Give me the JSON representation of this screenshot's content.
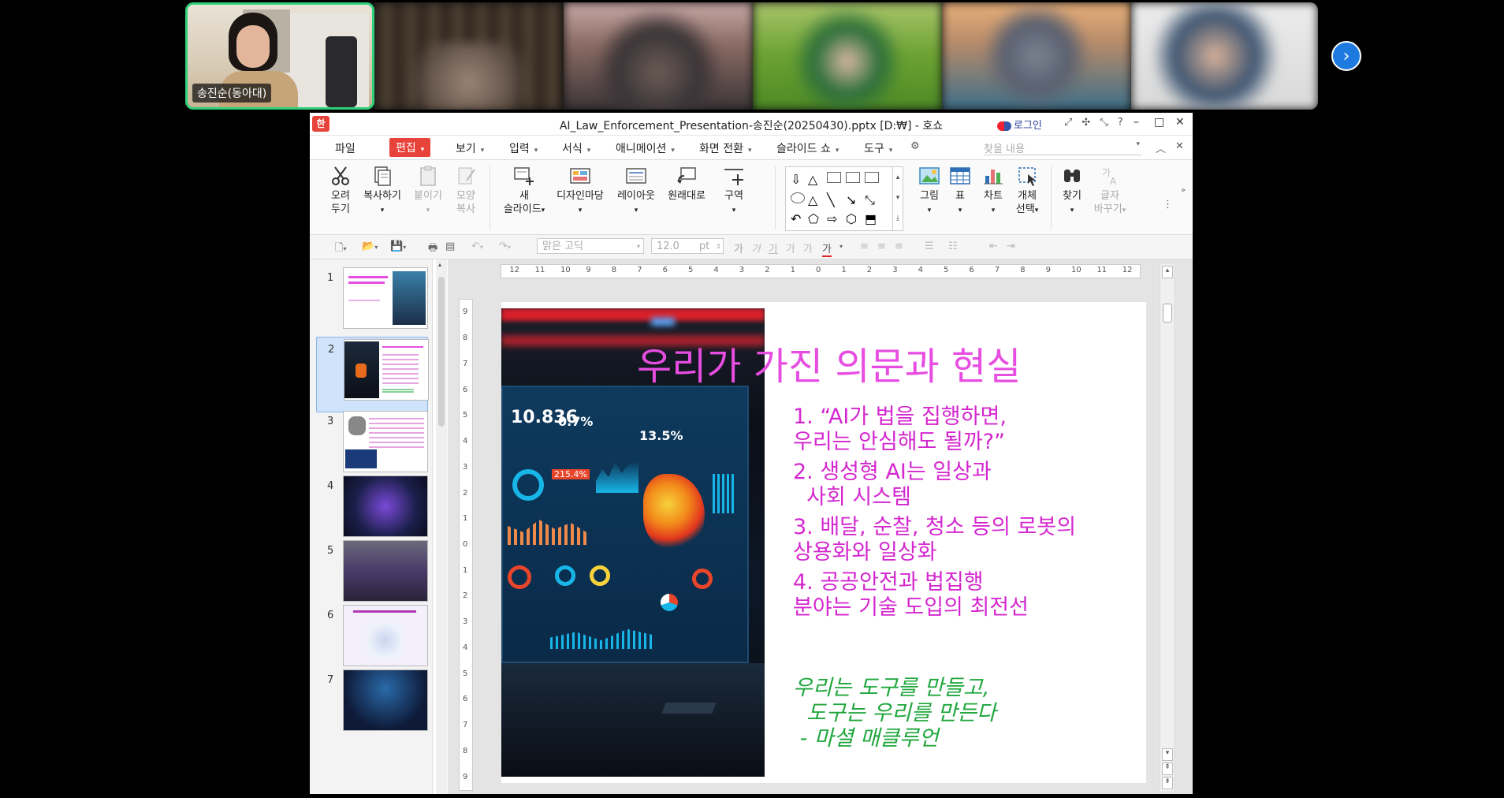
{
  "meeting": {
    "self_name": "송진순(동아대)",
    "next_label": "›"
  },
  "window": {
    "app_logo": "한",
    "title": "AI_Law_Enforcement_Presentation-송진순(20250430).pptx [D:₩] - 호쇼",
    "login": "로그인",
    "help": "?",
    "minimize": "–",
    "maximize": "□",
    "close": "✕"
  },
  "menu": {
    "items": [
      "파일",
      "편집",
      "보기",
      "입력",
      "서식",
      "애니메이션",
      "화면 전환",
      "슬라이드 쇼",
      "도구"
    ],
    "active_index": 1,
    "search_placeholder": "찾을 내용"
  },
  "ribbon": {
    "cut": [
      "오려",
      "두기"
    ],
    "copy": "복사하기",
    "paste": "붙이기",
    "format_copy": [
      "모양",
      "복사"
    ],
    "new_slide": [
      "새",
      "슬라이드"
    ],
    "design": "디자인마당",
    "layout": "레이아웃",
    "reset": "원래대로",
    "section": "구역",
    "picture": "그림",
    "table": "표",
    "chart": "차트",
    "select_object": [
      "개체",
      "선택"
    ],
    "find": "찾기",
    "replace_font": [
      "글자",
      "바꾸기"
    ]
  },
  "format_bar": {
    "font": "맑은 고딕",
    "size": "12.0",
    "unit": "pt",
    "char_sample": "가"
  },
  "slides": {
    "numbers": [
      "1",
      "2",
      "3",
      "4",
      "5",
      "6",
      "7"
    ],
    "selected_index": 1
  },
  "ruler": {
    "h_ticks": [
      "12",
      "11",
      "10",
      "9",
      "8",
      "7",
      "6",
      "5",
      "4",
      "3",
      "2",
      "1",
      "0",
      "1",
      "2",
      "3",
      "4",
      "5",
      "6",
      "7",
      "8",
      "9",
      "10",
      "11",
      "12"
    ],
    "v_ticks": [
      "9",
      "8",
      "7",
      "6",
      "5",
      "4",
      "3",
      "2",
      "1",
      "0",
      "1",
      "2",
      "3",
      "4",
      "5",
      "6",
      "7",
      "8",
      "9"
    ]
  },
  "slide": {
    "title": "우리가 가진 의문과 현실",
    "points": [
      [
        "1. “AI가 법을 집행하면,",
        "우리는 안심해도 될까?”"
      ],
      [
        "2. 생성형 AI는 일상과",
        "  사회 시스템"
      ],
      [
        "3. 배달, 순찰, 청소 등의 로봇의",
        "상용화와 일상화"
      ],
      [
        "4. 공공안전과 법집행",
        "분야는 기술 도입의 최전선"
      ]
    ],
    "quote": [
      "우리는 도구를 만들고,",
      "  도구는 우리를 만든다",
      " - 마셜 매클루언"
    ],
    "dashboard_values": [
      "10.836",
      "0.7%",
      "13.5%",
      "215.4%"
    ],
    "colors": {
      "title": "#e64de0",
      "body": "#d427cf",
      "quote": "#1fa63c"
    }
  }
}
